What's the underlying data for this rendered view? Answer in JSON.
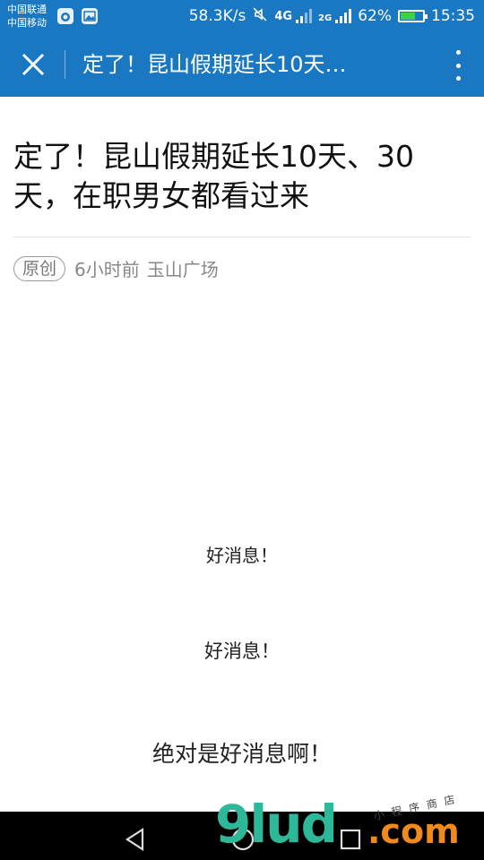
{
  "status_bar": {
    "carrier_1": "中国联通",
    "carrier_2": "中国移动",
    "net_speed": "58.3K/s",
    "sim1_type": "4G",
    "sim1_sub": "4G",
    "sim2_type": "2G",
    "battery_text": "62%",
    "battery_level": 0.62,
    "time": "15:35",
    "icons": [
      "weibo-notification-icon",
      "gallery-notification-icon",
      "mute-icon",
      "signal-icon",
      "battery-icon"
    ]
  },
  "app_bar": {
    "title": "定了！昆山假期延长10天…",
    "close_icon": "close-icon",
    "more_icon": "more-vert-icon"
  },
  "article": {
    "title": "定了！昆山假期延长10天、30天，在职男女都看过来",
    "badge": "原创",
    "time_ago": "6小时前",
    "source": "玉山广场",
    "lines": [
      "好消息！",
      "好消息！",
      "绝对是好消息啊！"
    ]
  },
  "nav_bar": {
    "icons": [
      "back-icon",
      "home-icon",
      "recent-apps-icon"
    ]
  },
  "watermark": {
    "logo": "9lud",
    "suffix": ".com",
    "tagline": "小程序商店"
  },
  "colors": {
    "app_blue": "#1a78c2",
    "battery_green": "#3fd14a",
    "watermark_green": "#2eb89a",
    "watermark_orange": "#f08a1c"
  }
}
